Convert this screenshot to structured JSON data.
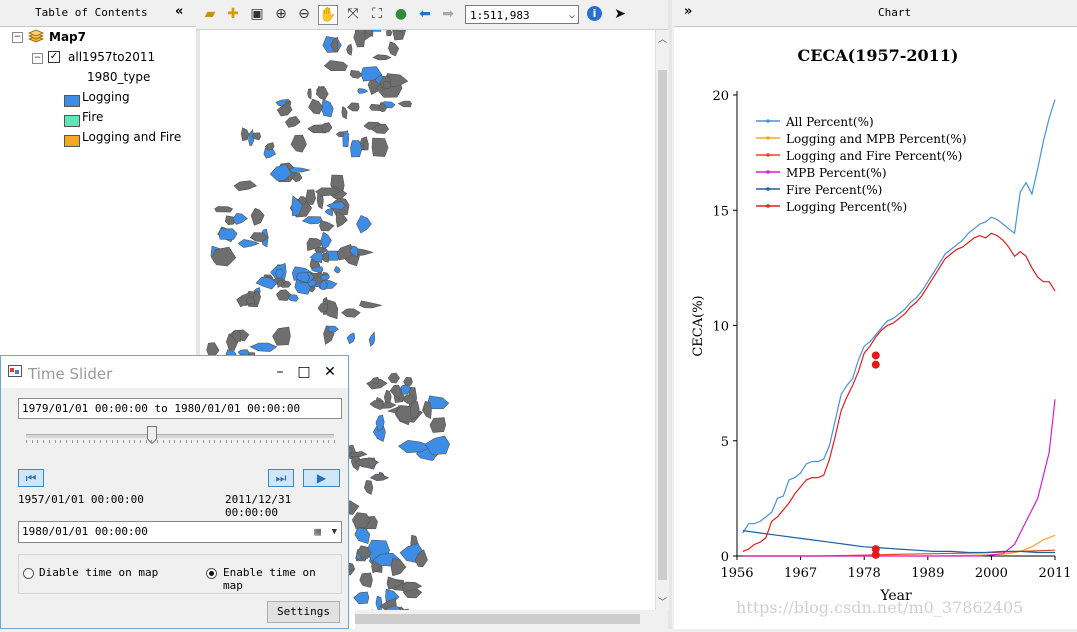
{
  "toc": {
    "title": "Table of Contents",
    "map_name": "Map7",
    "layer_name": "all1957to2011",
    "field_name": "1980_type",
    "legend": [
      {
        "label": "Logging",
        "color": "#3d8ce6"
      },
      {
        "label": "Fire",
        "color": "#5fe6b8"
      },
      {
        "label": "Logging and Fire",
        "color": "#f5a623"
      }
    ]
  },
  "toolbar": {
    "scale": "1:511,983",
    "icons": [
      "open-icon",
      "add-data-icon",
      "save-icon",
      "zoom-in-icon",
      "zoom-out-icon",
      "pan-icon",
      "full-extent-icon",
      "fixed-zoom-in-icon",
      "globe-icon",
      "back-icon",
      "forward-icon",
      "info-icon",
      "select-arrow-icon"
    ]
  },
  "chart_panel": {
    "header": "Chart",
    "collapse": "»"
  },
  "time_slider": {
    "title": "Time Slider",
    "range_text": "1979/01/01 00:00:00 to 1980/01/01 00:00:00",
    "start_label": "1957/01/01 00:00:00",
    "end_label": "2011/12/31 00:00:00",
    "current_time": "1980/01/01 00:00:00",
    "disable_label": "Diable time on map",
    "enable_label": "Enable time on map",
    "settings_label": "Settings",
    "slider_position": 0.41
  },
  "watermark": "https://blog.csdn.net/m0_37862405",
  "chart_data": {
    "type": "line",
    "title": "CECA(1957-2011)",
    "xlabel": "Year",
    "ylabel": "CECA(%)",
    "xlim": [
      1956,
      2011
    ],
    "ylim": [
      0,
      20
    ],
    "xticks": [
      1956,
      1967,
      1978,
      1989,
      2000,
      2011
    ],
    "yticks": [
      0,
      5,
      10,
      15,
      20
    ],
    "grid": false,
    "legend_position": "top-left",
    "series": [
      {
        "name": "All Percent(%)",
        "color": "#4a90d9",
        "x": [
          1957,
          1958,
          1959,
          1960,
          1961,
          1962,
          1963,
          1964,
          1965,
          1966,
          1967,
          1968,
          1969,
          1970,
          1971,
          1972,
          1973,
          1974,
          1975,
          1976,
          1977,
          1978,
          1979,
          1980,
          1981,
          1982,
          1983,
          1984,
          1985,
          1986,
          1987,
          1988,
          1989,
          1990,
          1991,
          1992,
          1993,
          1994,
          1995,
          1996,
          1997,
          1998,
          1999,
          2000,
          2001,
          2002,
          2003,
          2004,
          2005,
          2006,
          2007,
          2008,
          2009,
          2010,
          2011
        ],
        "y": [
          1.0,
          1.4,
          1.4,
          1.5,
          1.7,
          1.9,
          2.5,
          2.6,
          3.3,
          3.4,
          3.6,
          4.0,
          4.1,
          4.1,
          4.2,
          4.8,
          5.9,
          7.0,
          7.4,
          7.7,
          8.5,
          9.1,
          9.3,
          9.6,
          9.9,
          10.2,
          10.3,
          10.5,
          10.7,
          11.0,
          11.2,
          11.5,
          11.9,
          12.3,
          12.7,
          13.1,
          13.3,
          13.5,
          13.7,
          14.0,
          14.2,
          14.4,
          14.5,
          14.7,
          14.6,
          14.4,
          14.2,
          14.0,
          15.8,
          16.2,
          15.7,
          16.8,
          18.0,
          19.0,
          19.8
        ]
      },
      {
        "name": "Logging and MPB Percent(%)",
        "color": "#f5a623",
        "x": [
          1957,
          1970,
          1980,
          1990,
          2000,
          2003,
          2005,
          2007,
          2009,
          2011
        ],
        "y": [
          0,
          0,
          0,
          0,
          0.05,
          0.1,
          0.2,
          0.4,
          0.7,
          0.9
        ]
      },
      {
        "name": "Logging and Fire Percent(%)",
        "color": "#e8402a",
        "x": [
          1957,
          1970,
          1975,
          1980,
          1985,
          1990,
          1995,
          2000,
          2005,
          2011
        ],
        "y": [
          0,
          0,
          0.02,
          0.05,
          0.08,
          0.1,
          0.12,
          0.15,
          0.2,
          0.25
        ]
      },
      {
        "name": "MPB Percent(%)",
        "color": "#d61ed6",
        "x": [
          1957,
          1990,
          1998,
          2000,
          2002,
          2004,
          2006,
          2008,
          2010,
          2011
        ],
        "y": [
          0,
          0,
          0,
          0.05,
          0.1,
          0.5,
          1.5,
          2.5,
          4.5,
          6.8
        ]
      },
      {
        "name": "Fire Percent(%)",
        "color": "#1f5fa0",
        "x": [
          1957,
          1960,
          1963,
          1966,
          1969,
          1972,
          1975,
          1978,
          1981,
          1984,
          1987,
          1990,
          1993,
          1996,
          1999,
          2002,
          2005,
          2008,
          2011
        ],
        "y": [
          1.1,
          1.0,
          0.9,
          0.8,
          0.7,
          0.6,
          0.5,
          0.4,
          0.35,
          0.3,
          0.25,
          0.2,
          0.2,
          0.15,
          0.15,
          0.2,
          0.2,
          0.15,
          0.15
        ]
      },
      {
        "name": "Logging Percent(%)",
        "color": "#e01f1f",
        "x": [
          1957,
          1958,
          1959,
          1960,
          1961,
          1962,
          1963,
          1964,
          1965,
          1966,
          1967,
          1968,
          1969,
          1970,
          1971,
          1972,
          1973,
          1974,
          1975,
          1976,
          1977,
          1978,
          1979,
          1980,
          1981,
          1982,
          1983,
          1984,
          1985,
          1986,
          1987,
          1988,
          1989,
          1990,
          1991,
          1992,
          1993,
          1994,
          1995,
          1996,
          1997,
          1998,
          1999,
          2000,
          2001,
          2002,
          2003,
          2004,
          2005,
          2006,
          2007,
          2008,
          2009,
          2010,
          2011
        ],
        "y": [
          0.2,
          0.3,
          0.5,
          0.6,
          0.8,
          1.5,
          1.7,
          2.0,
          2.3,
          2.7,
          3.0,
          3.3,
          3.4,
          3.4,
          3.5,
          4.2,
          5.2,
          6.3,
          6.9,
          7.4,
          8.0,
          8.8,
          9.1,
          9.5,
          9.8,
          10.0,
          10.1,
          10.3,
          10.5,
          10.8,
          11.0,
          11.3,
          11.7,
          12.1,
          12.5,
          12.9,
          13.1,
          13.3,
          13.4,
          13.6,
          13.8,
          13.9,
          13.8,
          14.0,
          13.9,
          13.7,
          13.4,
          13.0,
          13.2,
          13.0,
          12.5,
          12.1,
          11.9,
          11.9,
          11.5
        ]
      }
    ],
    "markers": [
      {
        "x": 1980,
        "y": 8.7
      },
      {
        "x": 1980,
        "y": 8.3
      },
      {
        "x": 1980,
        "y": 0.3
      },
      {
        "x": 1980,
        "y": 0.05
      }
    ]
  }
}
